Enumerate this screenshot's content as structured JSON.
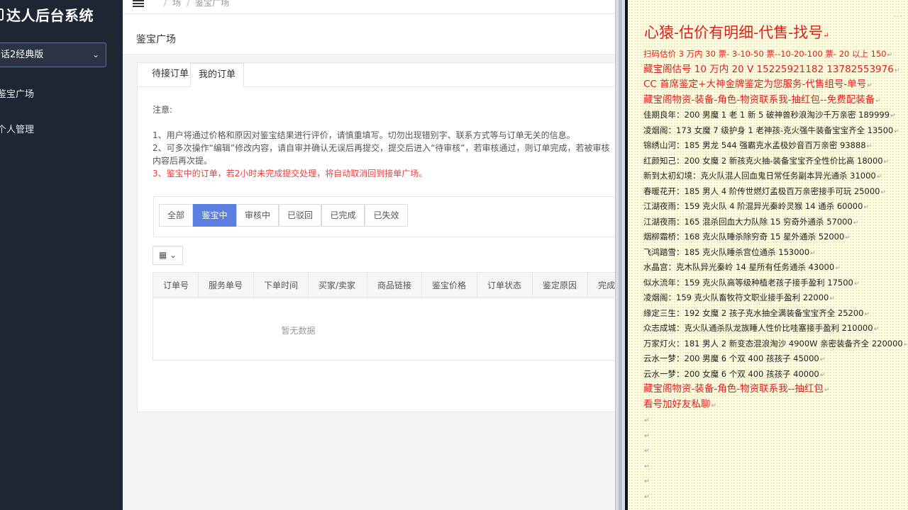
{
  "sidebar": {
    "brand": "达人后台系统",
    "site_select": "话2经典版",
    "items": [
      {
        "label": "鉴宝广场"
      },
      {
        "label": "个人管理"
      }
    ]
  },
  "topbar": {
    "breadcrumb": [
      "场",
      "鉴宝广场"
    ]
  },
  "page": {
    "title": "鉴宝广场",
    "tabs": [
      {
        "label": "待接订单"
      },
      {
        "label": "我的订单"
      }
    ],
    "notice": {
      "heading": "注意:",
      "items": [
        "1、用户将通过价格和原因对鉴宝结果进行评价，请慎重填写。切勿出现错别字、联系方式等与订单无关的信息。",
        "2、可多次操作“编辑”修改内容，请自审并确认无误后再提交，提交后进入“待审核”，若审核通过，则订单完成，若被审核",
        "内容后再次提。",
        "3、鉴宝中的订单，若2小时未完成提交处理，将自动取消回到接单广场。"
      ]
    },
    "filters": [
      {
        "label": "全部"
      },
      {
        "label": "鉴宝中"
      },
      {
        "label": "审核中"
      },
      {
        "label": "已驳回"
      },
      {
        "label": "已完成"
      },
      {
        "label": "已失效"
      }
    ],
    "table": {
      "columns": [
        "订单号",
        "服务单号",
        "下单时间",
        "买家/卖家",
        "商品链接",
        "鉴宝价格",
        "订单状态",
        "鉴定原因",
        "完成"
      ],
      "empty_text": "暂无数据"
    }
  },
  "document": {
    "watermark": "...",
    "title": "心猿-估价有明细-代售-找号",
    "lines": [
      {
        "text": "扫码估价 3 万内 30 票- 3-10-50 票--10-20-100 票- 20 以上 150",
        "style": "red"
      },
      {
        "text": "藏宝阁估号 10 万内 20 V 15225921182   13782553976",
        "style": "red big"
      },
      {
        "text": "CC 首席鉴定+大神金牌鉴定为您服务-代售组号-单号",
        "style": "red big"
      },
      {
        "text": "藏宝阁物资-装备-角色-物资联系我-抽红包--免费配装备",
        "style": "red big"
      },
      {
        "text": "佳期良年：200 男魔 1 老 1 新 5 破神兽秒浪淘沙千万亲密 189999",
        "style": ""
      },
      {
        "text": "凌烟阁：173 女魔 7 级护身 1 老神孩-克火强牛装备宝宝齐全 13500",
        "style": ""
      },
      {
        "text": "锦绣山河：185 男龙 544 强霸克水孟极妙音百万亲密 93888",
        "style": ""
      },
      {
        "text": "红颜知己：200 女魔 2 新孩克火抽-装备宝宝齐全性价比高 18000",
        "style": ""
      },
      {
        "text": "新到太初幻境：克火队混人回血鬼日常任务副本异光通杀 31000",
        "style": ""
      },
      {
        "text": "春暖花开：185 男人 4 阶传世燃灯孟极百万亲密接手可玩 25000",
        "style": ""
      },
      {
        "text": "江湖夜雨：159 克火队 4 阶混异光秦岭灵猴 14 通杀 60000",
        "style": ""
      },
      {
        "text": "江湖夜雨：165 混杀回血大力队除 15 穷奇外通杀 57000",
        "style": ""
      },
      {
        "text": "烟柳霜桥：168 克火队睡杀除穷奇 15 星外通杀 52000",
        "style": ""
      },
      {
        "text": "飞鸿踏雪：185 克火队睡杀宫位通杀 153000",
        "style": ""
      },
      {
        "text": "水晶宫：克木队异光秦岭 14 星所有任务通杀 43000",
        "style": ""
      },
      {
        "text": "似水流年：159 克火队高等级种植老孩子接手盈利 17500",
        "style": ""
      },
      {
        "text": "凌烟阁：159 克火队畜牧符文职业接手盈利 22000",
        "style": ""
      },
      {
        "text": "缘定三生：192 女魔 2 孩子克水抽全满装备宝宝齐全 25200",
        "style": ""
      },
      {
        "text": "众志成城：克火队通杀队龙族睡人性价比哇塞接手盈利 210000",
        "style": ""
      },
      {
        "text": "万家灯火：181 男人 2 新变态混浪淘沙 4900W 亲密装备齐全 220000",
        "style": ""
      },
      {
        "text": "云水一梦：200 男魔 6 个双 400 孩孩子 45000",
        "style": ""
      },
      {
        "text": "云水一梦：200 女魔 6 个双 400 孩孩子 40000",
        "style": ""
      },
      {
        "text": "藏宝阁物资-装备-角色-物资联系我--抽红包",
        "style": "red big"
      },
      {
        "text": "看号加好友私聊",
        "style": "red big"
      },
      {
        "text": "",
        "style": ""
      },
      {
        "text": "",
        "style": ""
      },
      {
        "text": "",
        "style": ""
      },
      {
        "text": "",
        "style": ""
      },
      {
        "text": "",
        "style": ""
      },
      {
        "text": "",
        "style": ""
      },
      {
        "text": "",
        "style": ""
      }
    ]
  },
  "colors": {
    "sidebar_bg": "#1f2533",
    "accent": "#5b7fe0",
    "warning_red": "#f23c3c",
    "doc_red": "#e02020"
  }
}
